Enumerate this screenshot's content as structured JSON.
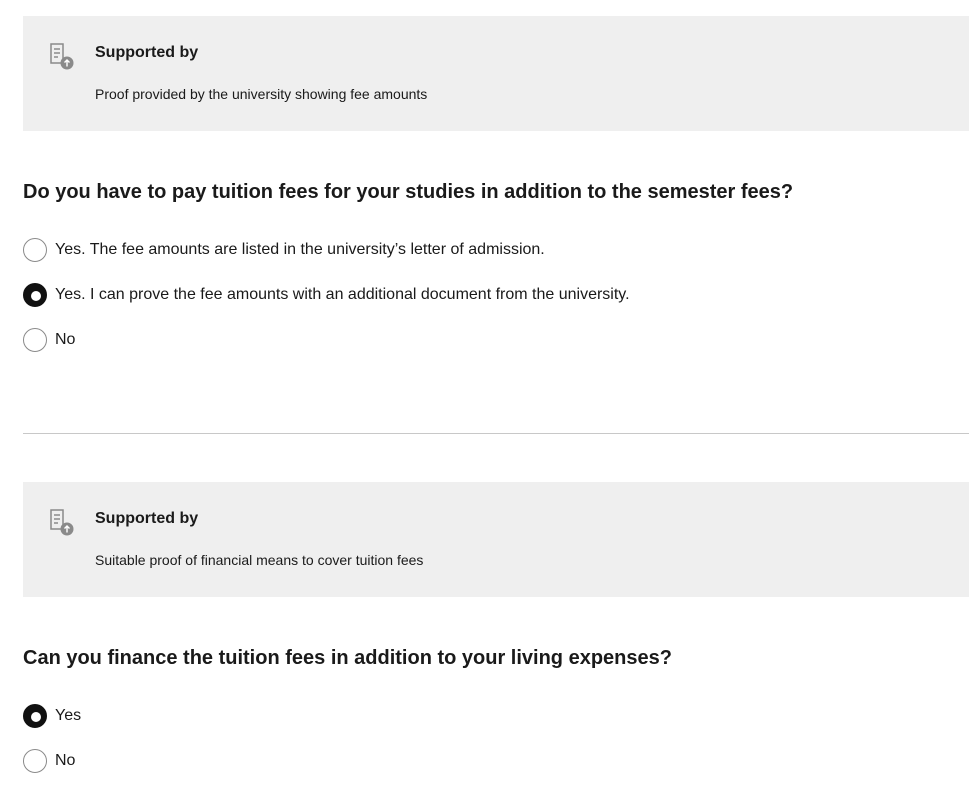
{
  "section1": {
    "support": {
      "icon": "document-upload-icon",
      "title": "Supported by",
      "text": "Proof provided by the university showing fee amounts"
    },
    "question": "Do you have to pay tuition fees for your studies in addition to the semester fees?",
    "options": [
      {
        "label": "Yes. The fee amounts are listed in the university’s letter of admission.",
        "selected": false
      },
      {
        "label": "Yes. I can prove the fee amounts with an additional document from the university.",
        "selected": true
      },
      {
        "label": "No",
        "selected": false
      }
    ]
  },
  "section2": {
    "support": {
      "icon": "document-upload-icon",
      "title": "Supported by",
      "text": "Suitable proof of financial means to cover tuition fees"
    },
    "question": "Can you finance the tuition fees in addition to your living expenses?",
    "options": [
      {
        "label": "Yes",
        "selected": true
      },
      {
        "label": "No",
        "selected": false
      }
    ]
  },
  "colors": {
    "support_background": "#efefef",
    "radio_selected": "#111111",
    "divider": "#c8c8c8"
  }
}
